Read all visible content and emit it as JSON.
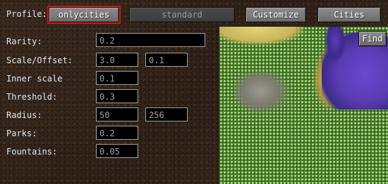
{
  "header": {
    "profile_label": "Profile:",
    "profiles": [
      "onlycities",
      "standard"
    ],
    "selected_profile": "onlycities",
    "customize_label": "Customize",
    "cities_label": "Cities"
  },
  "settings": {
    "rarity": {
      "label": "Rarity:",
      "value": "0.2"
    },
    "scale_offset": {
      "label": "Scale/Offset:",
      "scale": "3.0",
      "offset": "0.1"
    },
    "inner_scale": {
      "label": "Inner scale",
      "value": "0.1"
    },
    "threshold": {
      "label": "Threshold:",
      "value": "0.3"
    },
    "radius": {
      "label": "Radius:",
      "min": "50",
      "max": "256"
    },
    "parks": {
      "label": "Parks:",
      "value": "0.2"
    },
    "fountains": {
      "label": "Fountains:",
      "value": "0.05"
    }
  },
  "map": {
    "find_label": "Find",
    "colors": {
      "grass": "#4f7a28",
      "water": "#5a3cb4",
      "sand": "#d8c46a",
      "city": "#8a8a80"
    }
  }
}
